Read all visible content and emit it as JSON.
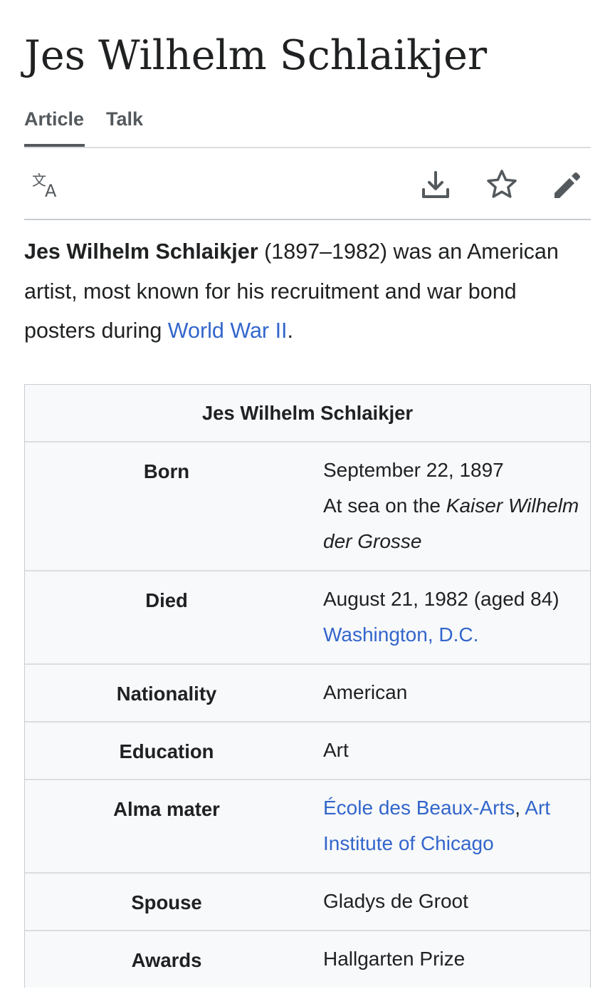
{
  "page": {
    "title": "Jes Wilhelm Schlaikjer"
  },
  "tabs": [
    {
      "label": "Article",
      "active": true
    },
    {
      "label": "Talk",
      "active": false
    }
  ],
  "toolbar": {
    "icons": [
      "translate-icon",
      "download-icon",
      "star-icon",
      "edit-pencil-icon"
    ]
  },
  "lead": {
    "subject": "Jes Wilhelm Schlaikjer",
    "text_before_link": " (1897–1982) was an American artist, most known for his recruitment and war bond posters during ",
    "link": "World War II",
    "text_after_link": "."
  },
  "infobox": {
    "caption": "Jes Wilhelm Schlaikjer",
    "born": {
      "label": "Born",
      "date": "September 22, 1897",
      "place_prefix": "At sea on the ",
      "ship": "Kaiser Wilhelm der Grosse"
    },
    "died": {
      "label": "Died",
      "date": "August 21, 1982 (aged 84)",
      "place_link": "Washington, D.C."
    },
    "nationality": {
      "label": "Nationality",
      "value": "American"
    },
    "education": {
      "label": "Education",
      "value": "Art"
    },
    "alma_mater": {
      "label": "Alma mater",
      "link1": "École des Beaux-Arts",
      "separator": ", ",
      "link2": "Art Institute of Chicago"
    },
    "spouse": {
      "label": "Spouse",
      "value": "Gladys de Groot"
    },
    "awards": {
      "label": "Awards",
      "value": "Hallgarten Prize"
    }
  },
  "colors": {
    "link": "#3366cc",
    "text": "#202122",
    "infobox_bg": "#f8f9fa",
    "border": "#c8ccd1"
  }
}
